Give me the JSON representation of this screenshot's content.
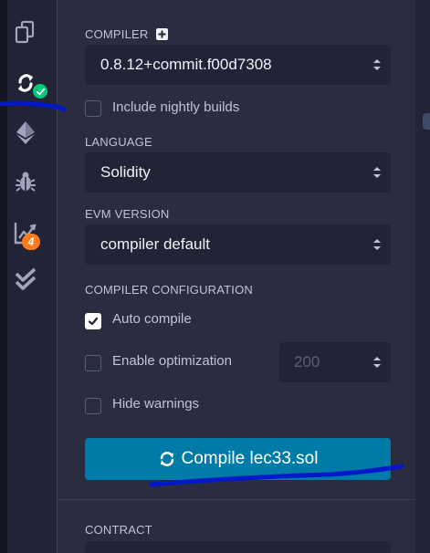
{
  "sidebar": {
    "icons": [
      {
        "name": "file-explorer-icon",
        "active": false
      },
      {
        "name": "solidity-compiler-icon",
        "active": true
      },
      {
        "name": "deploy-run-icon",
        "active": false
      },
      {
        "name": "debugger-icon",
        "active": false
      },
      {
        "name": "analysis-icon",
        "active": false
      },
      {
        "name": "unit-testing-icon",
        "active": false
      }
    ],
    "analysis_badge": "4"
  },
  "compiler": {
    "label": "COMPILER",
    "version": "0.8.12+commit.f00d7308",
    "include_nightly_label": "Include nightly builds",
    "include_nightly_checked": false
  },
  "language": {
    "label": "LANGUAGE",
    "value": "Solidity"
  },
  "evm": {
    "label": "EVM VERSION",
    "value": "compiler default"
  },
  "config": {
    "label": "COMPILER CONFIGURATION",
    "auto_compile_label": "Auto compile",
    "auto_compile_checked": true,
    "optimization_label": "Enable optimization",
    "optimization_checked": false,
    "optimization_runs": "200",
    "hide_warnings_label": "Hide warnings",
    "hide_warnings_checked": false
  },
  "compile_button": {
    "label": "Compile lec33.sol"
  },
  "contract": {
    "label": "CONTRACT"
  },
  "colors": {
    "accent": "#007aa6",
    "success": "#00c97a",
    "badge": "#ff7a1a",
    "annotation": "#0019c8"
  }
}
